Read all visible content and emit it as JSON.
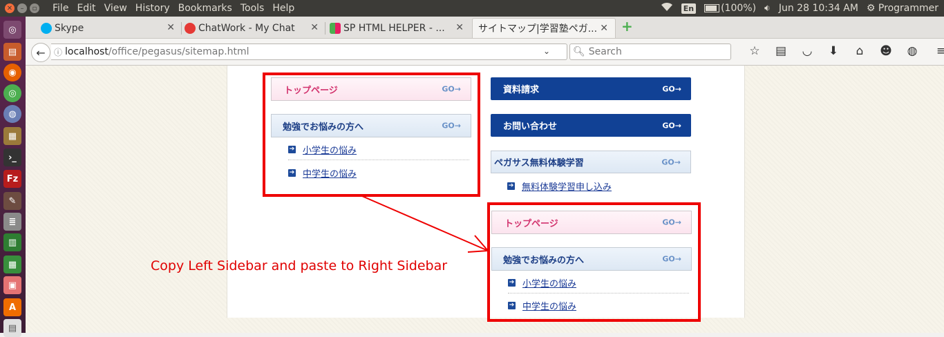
{
  "system": {
    "menu": [
      "File",
      "Edit",
      "View",
      "History",
      "Bookmarks",
      "Tools",
      "Help"
    ],
    "keyboard": "En",
    "battery": "(100%)",
    "clock": "Jun 28 10:34 AM",
    "user": "Programmer"
  },
  "tabs": [
    {
      "label": "Skype",
      "favicon_color": "#00aff0"
    },
    {
      "label": "ChatWork - My Chat",
      "favicon_color": "#e53935"
    },
    {
      "label": "SP HTML HELPER - ...",
      "favicon_color": "#4caf50"
    },
    {
      "label": "サイトマップ|学習塾ペガ...",
      "favicon_color": "#ffffff"
    }
  ],
  "nav": {
    "url_host": "localhost",
    "url_path": "/office/pegasus/sitemap.html",
    "search_placeholder": "Search"
  },
  "left": {
    "top_page": "トップページ",
    "study": "勉強でお悩みの方へ",
    "links": [
      "小学生の悩み",
      "中学生の悩み"
    ]
  },
  "right": {
    "request": "資料請求",
    "contact": "お問い合わせ",
    "trial": "ペガサス無料体験学習",
    "trial_link": "無料体験学習申し込み",
    "top_page": "トップページ",
    "study": "勉強でお悩みの方へ",
    "links": [
      "小学生の悩み",
      "中学生の悩み"
    ]
  },
  "go_label": "GO→",
  "annotation": "Copy Left Sidebar and paste to Right Sidebar",
  "colors": {
    "annotation_red": "#ee0000",
    "dark_blue": "#114195",
    "pink_text": "#d2326d"
  }
}
